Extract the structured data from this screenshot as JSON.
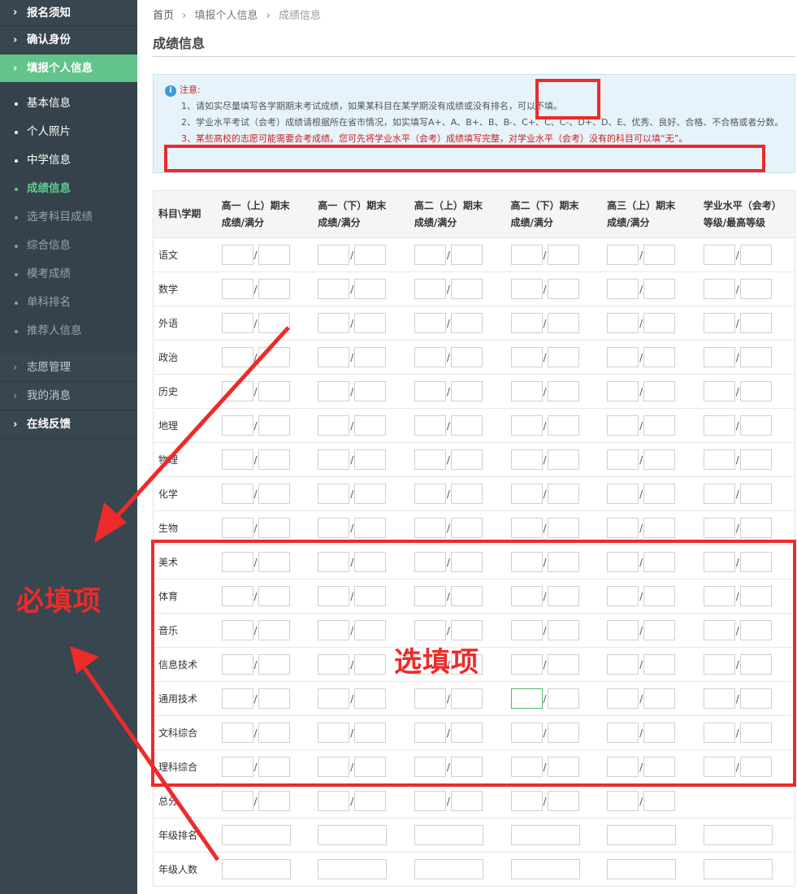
{
  "sidebar": {
    "top_items": [
      {
        "label": "报名须知"
      },
      {
        "label": "确认身份"
      },
      {
        "label": "填报个人信息"
      }
    ],
    "sub_items": [
      {
        "label": "基本信息"
      },
      {
        "label": "个人照片"
      },
      {
        "label": "中学信息"
      },
      {
        "label": "成绩信息"
      },
      {
        "label": "选考科目成绩"
      },
      {
        "label": "综合信息"
      },
      {
        "label": "模考成绩"
      },
      {
        "label": "单科排名"
      },
      {
        "label": "推荐人信息"
      }
    ],
    "bottom_items": [
      {
        "label": "志愿管理"
      },
      {
        "label": "我的消息"
      },
      {
        "label": "在线反馈"
      }
    ]
  },
  "breadcrumb": {
    "home": "首页",
    "section": "填报个人信息",
    "current": "成绩信息",
    "separator": "›"
  },
  "page_title": "成绩信息",
  "notice": {
    "icon": "info-icon",
    "title": "注意:",
    "line1": "1、请如实尽量填写各学期期末考试成绩，如果某科目在某学期没有成绩或没有排名，可以不填。",
    "line2": "2、学业水平考试（会考）成绩请根据所在省市情况，如实填写A+、A、B+、B、B-、C+、C、C-、D+、D、E、优秀、良好、合格、不合格或者分数。",
    "line3": "3、某些高校的志愿可能需要会考成绩。您可先将学业水平（会考）成绩填写完整，对学业水平（会考）没有的科目可以填“无”。"
  },
  "table": {
    "header_subject": "科目\\学期",
    "columns": [
      {
        "line1": "高一（上）期末",
        "line2": "成绩/满分"
      },
      {
        "line1": "高一（下）期末",
        "line2": "成绩/满分"
      },
      {
        "line1": "高二（上）期末",
        "line2": "成绩/满分"
      },
      {
        "line1": "高二（下）期末",
        "line2": "成绩/满分"
      },
      {
        "line1": "高三（上）期末",
        "line2": "成绩/满分"
      },
      {
        "line1": "学业水平（会考）",
        "line2": "等级/最高等级"
      }
    ],
    "separator": "/",
    "subjects": [
      "语文",
      "数学",
      "外语",
      "政治",
      "历史",
      "地理",
      "物理",
      "化学",
      "生物",
      "美术",
      "体育",
      "音乐",
      "信息技术",
      "通用技术",
      "文科综合",
      "理科综合"
    ],
    "summary_rows": [
      "总分",
      "年级排名",
      "年级人数"
    ]
  },
  "annotations": {
    "required_label": "必填项",
    "optional_label": "选填项",
    "color": "#ee2a2a"
  }
}
